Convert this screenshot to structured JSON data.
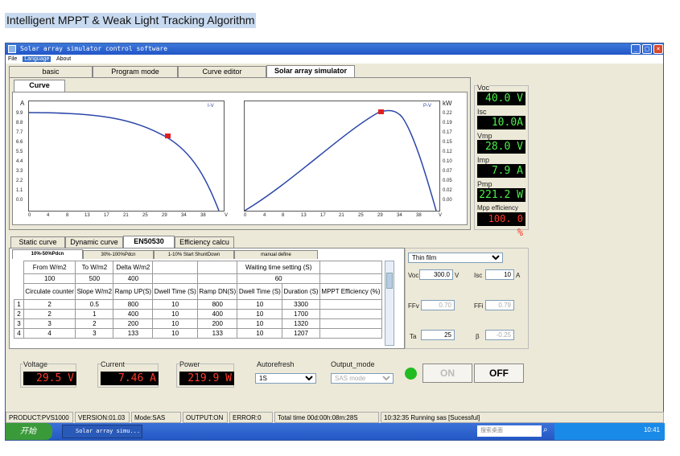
{
  "heading": "Intelligent MPPT & Weak Light Tracking Algorithm",
  "window": {
    "title": "Solar array simulator control software"
  },
  "menu": [
    "File",
    "Language",
    "About"
  ],
  "main_tabs": [
    "basic",
    "Program mode",
    "Curve editor",
    "Solar array simulator"
  ],
  "curve_tab": "Curve",
  "iv_chart": {
    "legend": "I-V",
    "ylabel": "A",
    "yticks": [
      "9.9",
      "8.8",
      "7.7",
      "6.6",
      "5.5",
      "4.4",
      "3.3",
      "2.2",
      "1.1",
      "0.0"
    ],
    "xticks": [
      "0",
      "4",
      "8",
      "13",
      "17",
      "21",
      "25",
      "29",
      "34",
      "38",
      "V"
    ]
  },
  "pv_chart": {
    "legend": "P-V",
    "ylabel": "kW",
    "yticks": [
      "0.22",
      "0.19",
      "0.17",
      "0.15",
      "0.12",
      "0.10",
      "0.07",
      "0.05",
      "0.02",
      "0.00"
    ],
    "xticks": [
      "0",
      "4",
      "8",
      "13",
      "17",
      "21",
      "25",
      "29",
      "34",
      "38",
      "V"
    ]
  },
  "readouts": {
    "voc": {
      "label": "Voc",
      "value": "40.0 V"
    },
    "isc": {
      "label": "Isc",
      "value": "10.0A"
    },
    "vmp": {
      "label": "Vmp",
      "value": "28.0 V"
    },
    "imp": {
      "label": "Imp",
      "value": "7.9 A"
    },
    "pmp": {
      "label": "Pmp",
      "value": "221.2 W"
    },
    "eff": {
      "label": "Mpp efficiency",
      "value": "100. 0 %"
    }
  },
  "lower_tabs": [
    "Static curve",
    "Dynamic curve",
    "EN50530",
    "Efficiency calcu"
  ],
  "sub_tabs": [
    "10%-50%Pdcn",
    "30%-100%Pdcn",
    "1-10% Start ShuntDown",
    "manual define"
  ],
  "table": {
    "row1": [
      "From W/m2",
      "To W/m2",
      "Delta W/m2",
      "",
      "",
      "Waiting time setting (S)",
      ""
    ],
    "row2": [
      "100",
      "500",
      "400",
      "",
      "",
      "60",
      ""
    ],
    "header": [
      "Circulate counter",
      "Slope W/m2",
      "Ramp UP(S)",
      "Dwell Time (S)",
      "Ramp DN(S)",
      "Dwell Time (S)",
      "Duration (S)",
      "MPPT Efficiency (%)"
    ],
    "rows": [
      [
        "1",
        "2",
        "0.5",
        "800",
        "10",
        "800",
        "10",
        "3300",
        ""
      ],
      [
        "2",
        "2",
        "1",
        "400",
        "10",
        "400",
        "10",
        "1700",
        ""
      ],
      [
        "3",
        "3",
        "2",
        "200",
        "10",
        "200",
        "10",
        "1320",
        ""
      ],
      [
        "4",
        "4",
        "3",
        "133",
        "10",
        "133",
        "10",
        "1207",
        ""
      ]
    ]
  },
  "params": {
    "film": "Thin film",
    "voc_label": "Voc",
    "voc_value": "300.0",
    "voc_unit": "V",
    "isc_label": "Isc",
    "isc_value": "10",
    "isc_unit": "A",
    "ffv_label": "FFv",
    "ffv_value": "0.70",
    "ffi_label": "FFi",
    "ffi_value": "0.79",
    "ta_label": "Ta",
    "ta_value": "25",
    "beta_label": "β",
    "beta_value": "-0.25"
  },
  "bottom": {
    "voltage_label": "Voltage",
    "voltage_value": "29.5 V",
    "current_label": "Current",
    "current_value": "7.46 A",
    "power_label": "Power",
    "power_value": "219.9 W",
    "autorefresh_label": "Autorefresh",
    "autorefresh_value": "1S",
    "output_mode_label": "Output_mode",
    "output_mode_value": "SAS mode",
    "on_label": "ON",
    "off_label": "OFF"
  },
  "status": {
    "product": "PRODUCT:PVS1000",
    "version": "VERSION:01.03",
    "mode": "Mode:SAS",
    "output": "OUTPUT:ON",
    "error": "ERROR:0",
    "total_time": "Total time 00d:00h:08m:28S",
    "message": "10:32:35 Running sas [Sucessful]"
  },
  "taskbar": {
    "start": "开始",
    "task": "Solar array simu...",
    "search": "搜索桌面",
    "clock": "10:41"
  },
  "colors": {
    "curve": "#2b46a8",
    "marker": "#e02020",
    "lcd_green": "#4cf04c",
    "lcd_red": "#ff3a2a",
    "on_led": "#22bb22"
  }
}
